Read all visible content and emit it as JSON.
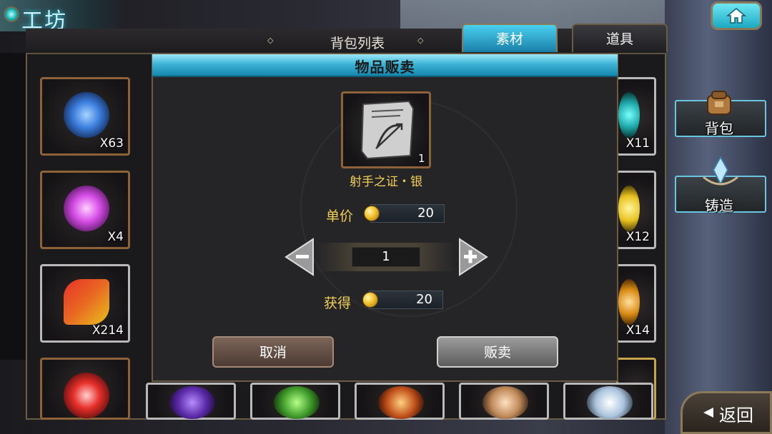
{
  "header": {
    "title": "工坊",
    "list_title": "背包列表"
  },
  "tabs": [
    {
      "label": "素材",
      "active": true
    },
    {
      "label": "道具",
      "active": false
    }
  ],
  "inventory": {
    "slots": [
      {
        "qty": "X63",
        "color": "#3d7fe0"
      },
      {
        "qty": "X4",
        "color": "#d850e8"
      },
      {
        "qty": "X214",
        "color": "#e86a22"
      },
      {
        "qty": "",
        "color": "#e8302a"
      },
      {
        "qty": "X11",
        "color": "#1ea6a6"
      },
      {
        "qty": "X12",
        "color": "#e8c21e"
      },
      {
        "qty": "X14",
        "color": "#d88a12"
      }
    ]
  },
  "dialog": {
    "title": "物品贩卖",
    "item_name": "射手之证・银",
    "item_count": "1",
    "unit_price_label": "单价",
    "unit_price_value": "20",
    "quantity": "1",
    "earn_label": "获得",
    "earn_value": "20",
    "cancel_label": "取消",
    "sell_label": "贩卖"
  },
  "side": {
    "bag_label": "背包",
    "forge_label": "铸造",
    "back_label": "返回"
  },
  "colors": {
    "accent_cyan": "#3db4d6",
    "gold_text": "#f1cf57",
    "frame_bronze": "#8e6238"
  }
}
